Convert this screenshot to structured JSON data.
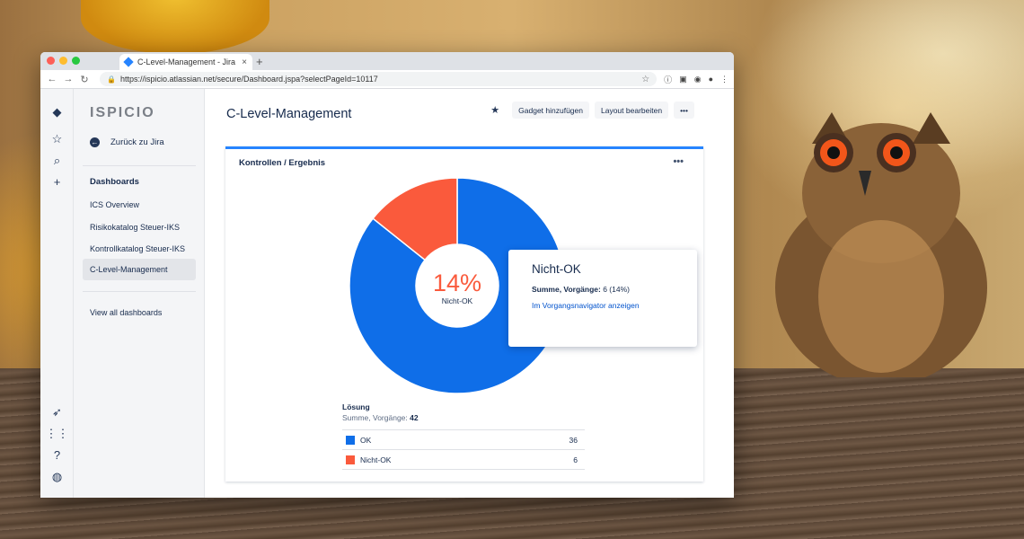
{
  "browser": {
    "tab_title": "C-Level-Management - Jira",
    "tab_close": "×",
    "new_tab": "+",
    "url": "https://ispicio.atlassian.net/secure/Dashboard.jspa?selectPageId=10117"
  },
  "sidebar": {
    "logo": "ISPICIO",
    "back_label": "Zurück zu Jira",
    "section_heading": "Dashboards",
    "items": [
      {
        "label": "ICS Overview"
      },
      {
        "label": "Risikokatalog Steuer-IKS"
      },
      {
        "label": "Kontrollkatalog Steuer-IKS"
      },
      {
        "label": "C-Level-Management"
      }
    ],
    "view_all": "View all dashboards"
  },
  "header": {
    "title": "C-Level-Management",
    "add_gadget": "Gadget hinzufügen",
    "edit_layout": "Layout bearbeiten",
    "more": "•••"
  },
  "gadget": {
    "title": "Kontrollen / Ergebnis",
    "more": "•••",
    "center_percent": "14%",
    "center_label": "Nicht-OK",
    "legend_heading": "Lösung",
    "legend_sum_label": "Summe, Vorgänge:",
    "legend_sum_value": "42",
    "tooltip": {
      "title": "Nicht-OK",
      "sum_label": "Summe, Vorgänge:",
      "sum_value": "6 (14%)",
      "link": "Im Vorgangsnavigator anzeigen"
    }
  },
  "chart_data": {
    "type": "pie",
    "categories": [
      "OK",
      "Nicht-OK"
    ],
    "values": [
      36,
      6
    ],
    "colors": [
      "#0f6ee8",
      "#fa5a3c"
    ],
    "legend_counts": [
      "36",
      "6"
    ]
  },
  "colors": {
    "accent": "#2684ff",
    "ok": "#0f6ee8",
    "nicht_ok": "#fa5a3c"
  }
}
